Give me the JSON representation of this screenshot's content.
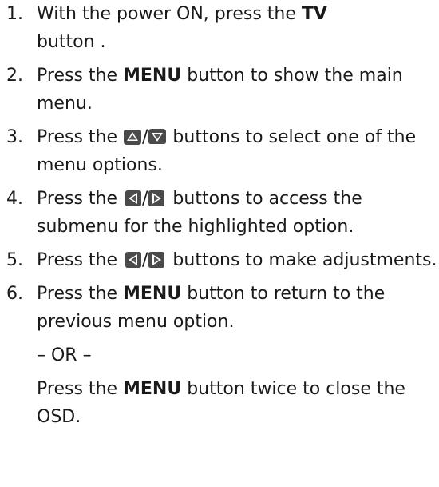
{
  "steps": [
    {
      "num": "1.",
      "t1": "With the power ON, press the ",
      "b1": "TV",
      "t2": " button ."
    },
    {
      "num": "2.",
      "t1": "Press the ",
      "b1": "MENU",
      "t2": " button to show the main menu."
    },
    {
      "num": "3.",
      "t1": "Press the ",
      "slash": "/",
      "t2": " buttons to select one of the menu options."
    },
    {
      "num": "4.",
      "t1": "Press the ",
      "slash": "/",
      "t2": " buttons to access the submenu for the highlighted option."
    },
    {
      "num": "5.",
      "t1": "Press the ",
      "slash": "/",
      "t2": " buttons to make adjustments."
    },
    {
      "num": "6.",
      "t1": "Press the ",
      "b1": "MENU",
      "t2": " button to return to the previous menu option.",
      "or": "– OR –",
      "t3": "Press the ",
      "b2": "MENU",
      "t4": " button twice to close the OSD."
    }
  ],
  "icons": {
    "up": "up-arrow-button-icon",
    "down": "down-arrow-button-icon",
    "left": "left-arrow-button-icon",
    "right": "right-arrow-button-icon"
  }
}
